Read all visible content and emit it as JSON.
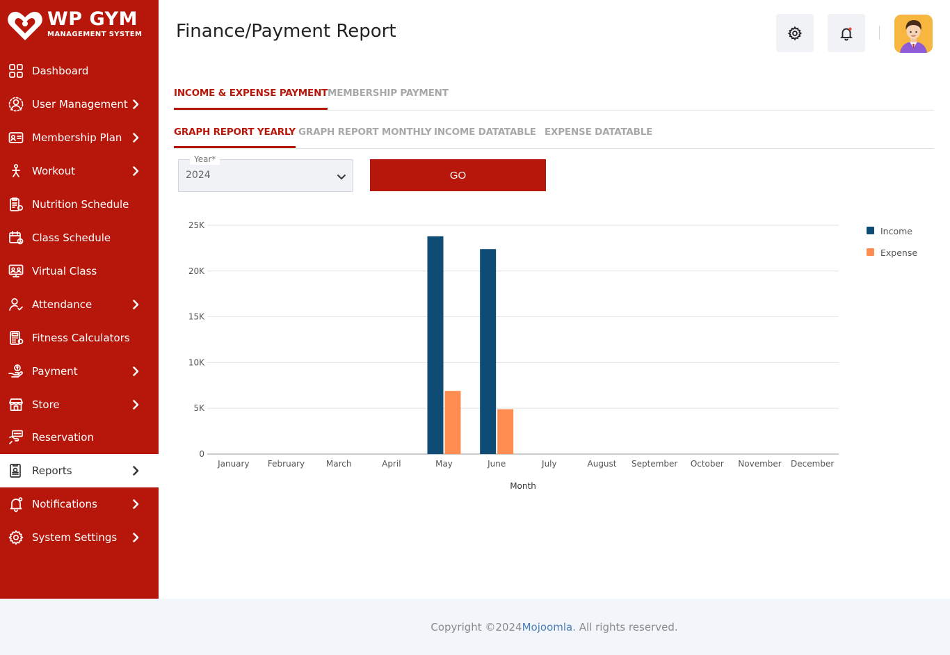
{
  "brand": {
    "title": "WP GYM",
    "subtitle": "MANAGEMENT SYSTEM"
  },
  "sidebar": {
    "items": [
      {
        "label": "Dashboard",
        "icon": "dashboard-grid-icon",
        "chevron": false
      },
      {
        "label": "User Management",
        "icon": "users-gear-icon",
        "chevron": true
      },
      {
        "label": "Membership Plan",
        "icon": "membership-card-icon",
        "chevron": true
      },
      {
        "label": "Workout",
        "icon": "workout-icon",
        "chevron": true
      },
      {
        "label": "Nutrition Schedule",
        "icon": "nutrition-clipboard-icon",
        "chevron": false
      },
      {
        "label": "Class Schedule",
        "icon": "calendar-icon",
        "chevron": false
      },
      {
        "label": "Virtual Class",
        "icon": "virtual-class-icon",
        "chevron": false
      },
      {
        "label": "Attendance",
        "icon": "attendance-user-check-icon",
        "chevron": true
      },
      {
        "label": "Fitness Calculators",
        "icon": "calculator-icon",
        "chevron": false
      },
      {
        "label": "Payment",
        "icon": "payment-hand-icon",
        "chevron": true
      },
      {
        "label": "Store",
        "icon": "store-icon",
        "chevron": true
      },
      {
        "label": "Reservation",
        "icon": "reservation-icon",
        "chevron": false
      },
      {
        "label": "Reports",
        "icon": "reports-icon",
        "chevron": true
      },
      {
        "label": "Notifications",
        "icon": "bell-icon",
        "chevron": true
      },
      {
        "label": "System Settings",
        "icon": "gear-icon",
        "chevron": true
      }
    ],
    "active": "Reports"
  },
  "header": {
    "title": "Finance/Payment Report"
  },
  "tabs_primary": [
    {
      "label": "INCOME & EXPENSE PAYMENT",
      "active": true
    },
    {
      "label": "MEMBERSHIP PAYMENT",
      "active": false
    }
  ],
  "tabs_secondary": [
    {
      "label": "GRAPH REPORT YEARLY",
      "active": true
    },
    {
      "label": "GRAPH REPORT MONTHLY",
      "active": false
    },
    {
      "label": "INCOME DATATABLE",
      "active": false
    },
    {
      "label": "EXPENSE DATATABLE",
      "active": false
    }
  ],
  "filter": {
    "year_label": "Year*",
    "year_value": "2024",
    "go_label": "GO"
  },
  "chart_data": {
    "type": "bar",
    "categories": [
      "January",
      "February",
      "March",
      "April",
      "May",
      "June",
      "July",
      "August",
      "September",
      "October",
      "November",
      "December"
    ],
    "series": [
      {
        "name": "Income",
        "color": "#0f4c75",
        "values": [
          0,
          0,
          0,
          0,
          23800,
          22400,
          0,
          0,
          0,
          0,
          0,
          0
        ]
      },
      {
        "name": "Expense",
        "color": "#ff8c50",
        "values": [
          0,
          0,
          0,
          0,
          6900,
          4900,
          0,
          0,
          0,
          0,
          0,
          0
        ]
      }
    ],
    "title": "",
    "xlabel": "Month",
    "ylabel": "",
    "ylim": [
      0,
      25000
    ],
    "yticks": [
      0,
      5000,
      10000,
      15000,
      20000,
      25000
    ],
    "ytick_labels": [
      "0",
      "5K",
      "10K",
      "15K",
      "20K",
      "25K"
    ],
    "grid": true,
    "legend": "right"
  },
  "footer": {
    "prefix": "Copyright ©2024 ",
    "brand": "Mojoomla",
    "suffix": ". All rights reserved."
  },
  "colors": {
    "sidebar_bg": "#b7170b",
    "accent": "#b7170b",
    "notification_dot": "#e74c3c"
  }
}
